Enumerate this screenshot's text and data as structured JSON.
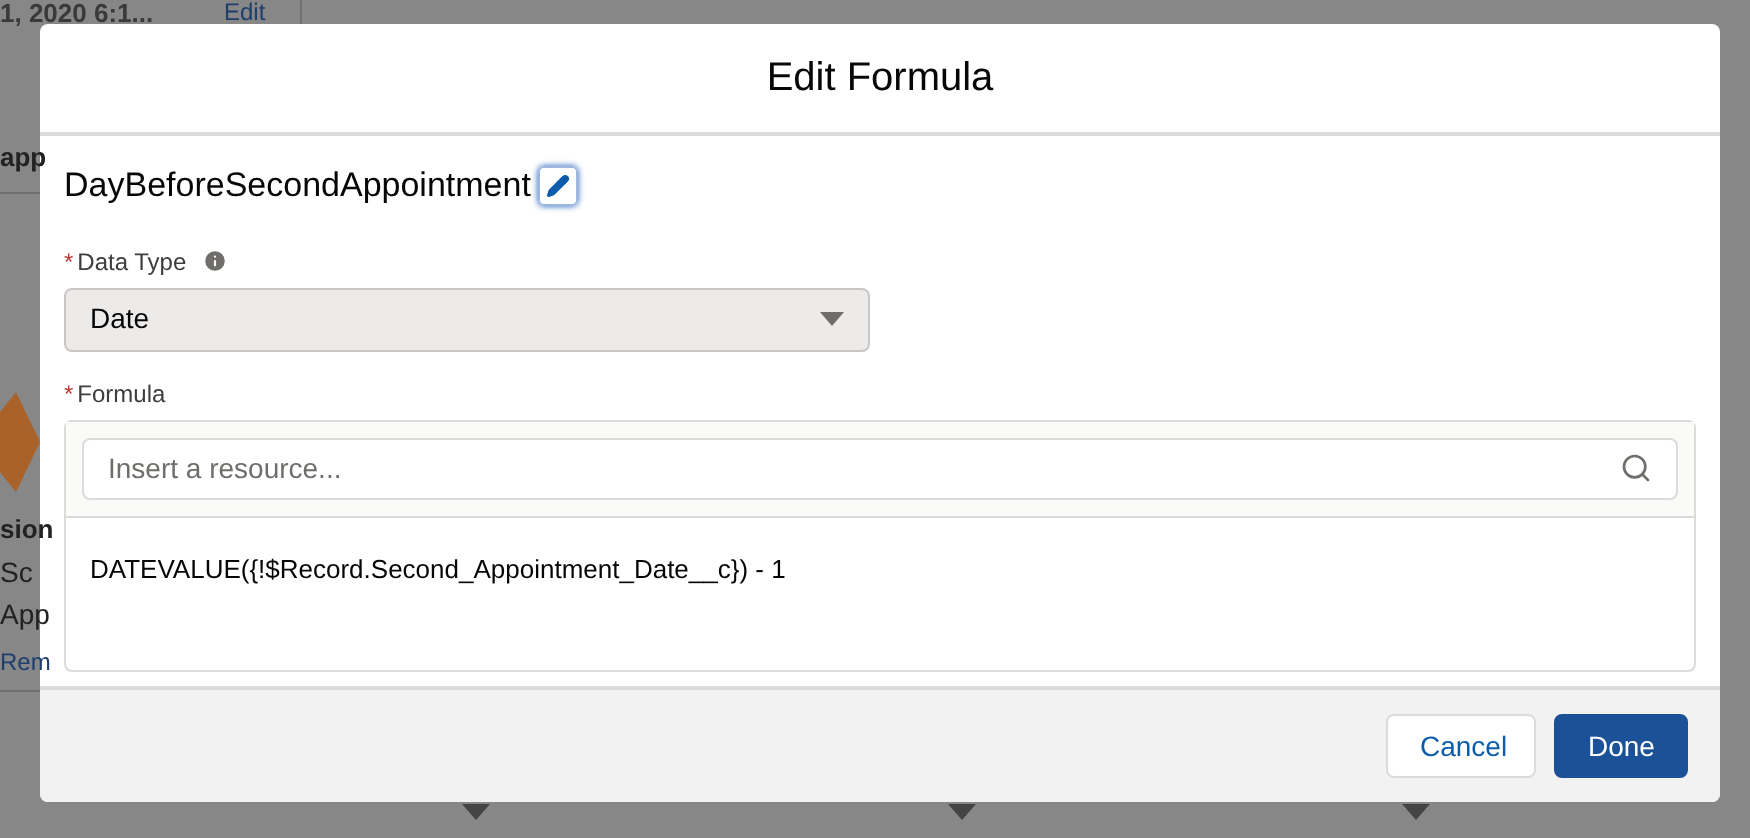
{
  "background": {
    "texts": [
      {
        "kind": "header",
        "text": "1, 2020 6:1..."
      },
      {
        "kind": "link",
        "text": "Edit"
      },
      {
        "kind": "bold",
        "text": "app"
      },
      {
        "kind": "bold",
        "text": "sion"
      },
      {
        "kind": "plain",
        "text": "Sc"
      },
      {
        "kind": "plain",
        "text": "App"
      },
      {
        "kind": "link",
        "text": "Rem"
      }
    ]
  },
  "modal": {
    "title": "Edit Formula",
    "api_name": "DayBeforeSecondAppointment",
    "data_type": {
      "required_mark": "*",
      "label": "Data Type",
      "value": "Date"
    },
    "formula": {
      "required_mark": "*",
      "label": "Formula",
      "placeholder": "Insert a resource...",
      "value": "DATEVALUE({!$Record.Second_Appointment_Date__c}) - 1"
    },
    "buttons": [
      {
        "label": "Cancel",
        "kind": "neutral"
      },
      {
        "label": "Done",
        "kind": "brand"
      }
    ]
  }
}
